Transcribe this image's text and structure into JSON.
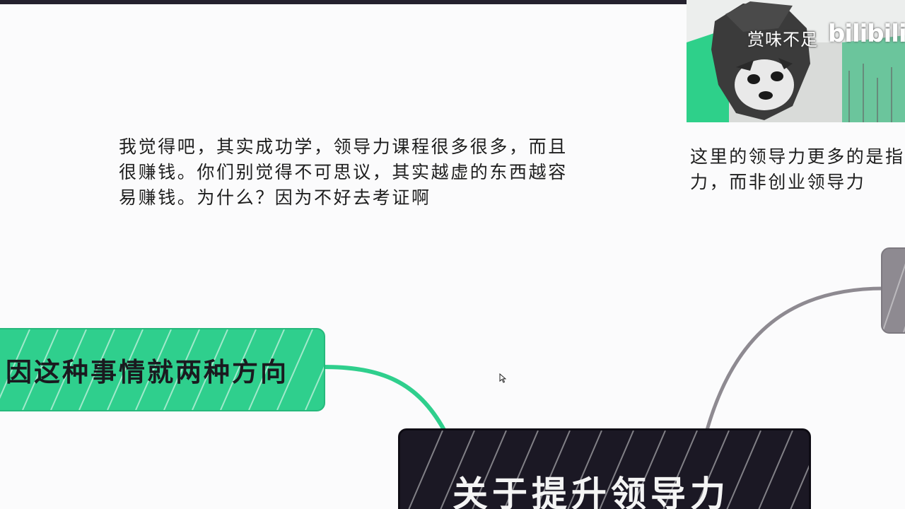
{
  "colors": {
    "background": "#fbfbfc",
    "accent_green": "#2fcf8d",
    "dark_node": "#1b1824",
    "gray_node": "#8e8a91",
    "text": "#1e1e1e"
  },
  "notes": {
    "left": {
      "line1": "我觉得吧，其实成功学，领导力课程很多很多，而且",
      "line2": "很赚钱。你们别觉得不可思议，其实越虚的东西越容",
      "line3": "易赚钱。为什么？因为不好去考证啊"
    },
    "right": {
      "line1": "这里的领导力更多的是指",
      "line2": "力，而非创业领导力"
    }
  },
  "nodes": {
    "green": {
      "label": "因这种事情就两种方向"
    },
    "center": {
      "label": "关于提升领导力"
    },
    "gray": {
      "label": ""
    }
  },
  "video": {
    "watermark": "赏味不足",
    "logo": "bilibili"
  },
  "icons": {
    "cursor": "mouse-cursor-icon",
    "presenter": "red-panda-avatar-icon"
  }
}
